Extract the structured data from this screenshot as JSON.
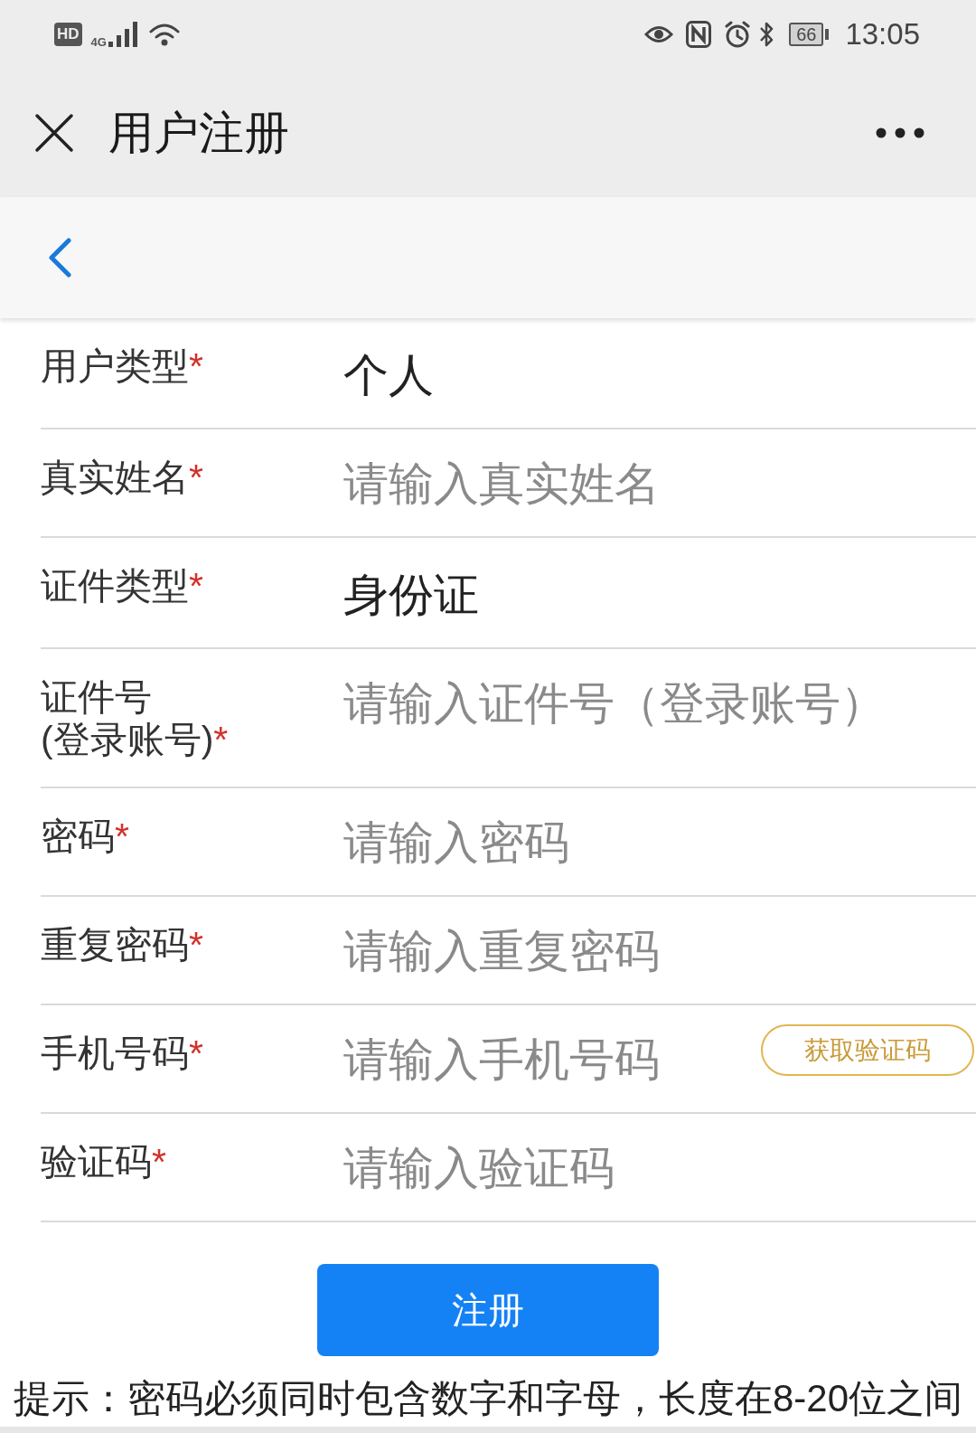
{
  "status_bar": {
    "hd_label": "HD",
    "network_type": "4G",
    "battery": "66",
    "time": "13:05"
  },
  "title_bar": {
    "title": "用户注册"
  },
  "form": {
    "rows": [
      {
        "kind": "select",
        "label": "用户类型",
        "required_mark": "*",
        "value": "个人"
      },
      {
        "kind": "input",
        "label": "真实姓名",
        "required_mark": "*",
        "placeholder": "请输入真实姓名"
      },
      {
        "kind": "select",
        "label": "证件类型",
        "required_mark": "*",
        "value": "身份证"
      },
      {
        "kind": "input",
        "label": "证件号\n(登录账号)",
        "required_mark": "*",
        "placeholder": "请输入证件号（登录账号）"
      },
      {
        "kind": "password",
        "label": "密码",
        "required_mark": "*",
        "placeholder": "请输入密码"
      },
      {
        "kind": "password",
        "label": "重复密码",
        "required_mark": "*",
        "placeholder": "请输入重复密码"
      },
      {
        "kind": "input",
        "label": "手机号码",
        "required_mark": "*",
        "placeholder": "请输入手机号码",
        "action_button": "获取验证码"
      },
      {
        "kind": "input",
        "label": "验证码",
        "required_mark": "*",
        "placeholder": "请输入验证码"
      }
    ]
  },
  "submit_button": "注册",
  "hint": "提示：密码必须同时包含数字和字母，长度在8-20位之间"
}
